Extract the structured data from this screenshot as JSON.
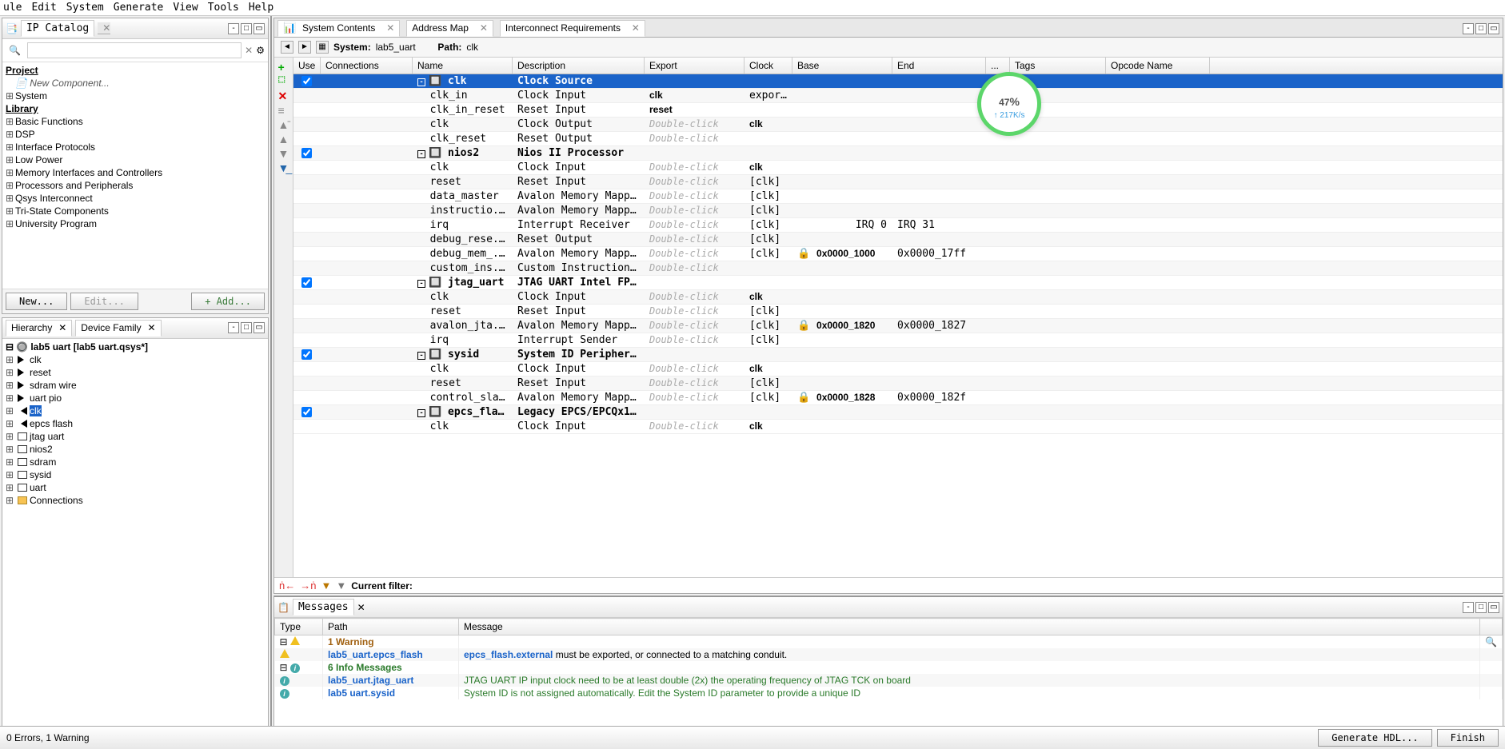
{
  "menu": [
    "ule",
    "Edit",
    "System",
    "Generate",
    "View",
    "Tools",
    "Help"
  ],
  "ip_catalog": {
    "title": "IP Catalog",
    "search_placeholder": "",
    "project_label": "Project",
    "new_component": "New Component...",
    "system": "System",
    "library_label": "Library",
    "items": [
      "Basic Functions",
      "DSP",
      "Interface Protocols",
      "Low Power",
      "Memory Interfaces and Controllers",
      "Processors and Peripherals",
      "Qsys Interconnect",
      "Tri-State Components",
      "University Program"
    ],
    "new_btn": "New...",
    "edit_btn": "Edit...",
    "add_btn": "+ Add..."
  },
  "hierarchy": {
    "tabs": [
      "Hierarchy",
      "Device Family"
    ],
    "root": "lab5 uart [lab5 uart.qsys*]",
    "items": [
      {
        "name": "clk",
        "icon": "right"
      },
      {
        "name": "reset",
        "icon": "right"
      },
      {
        "name": "sdram wire",
        "icon": "right"
      },
      {
        "name": "uart pio",
        "icon": "right"
      },
      {
        "name": "clk",
        "icon": "left",
        "selected": true
      },
      {
        "name": "epcs flash",
        "icon": "left"
      },
      {
        "name": "jtag uart",
        "icon": "chip"
      },
      {
        "name": "nios2",
        "icon": "chip"
      },
      {
        "name": "sdram",
        "icon": "chip"
      },
      {
        "name": "sysid",
        "icon": "chip"
      },
      {
        "name": "uart",
        "icon": "chip"
      },
      {
        "name": "Connections",
        "icon": "folder"
      }
    ]
  },
  "system_contents": {
    "tabs": [
      "System Contents",
      "Address Map",
      "Interconnect Requirements"
    ],
    "system_label": "System:",
    "system_name": "lab5_uart",
    "path_label": "Path:",
    "path_value": "clk",
    "columns": [
      "Use",
      "Connections",
      "Name",
      "Description",
      "Export",
      "Clock",
      "Base",
      "End",
      "...",
      "Tags",
      "Opcode Name"
    ],
    "filter_label": "Current filter:",
    "rows": [
      {
        "use": true,
        "comp": true,
        "selected": true,
        "name": "clk",
        "desc": "Clock Source"
      },
      {
        "name": "clk_in",
        "desc": "Clock Input",
        "export": "clk",
        "clock": "exporte"
      },
      {
        "name": "clk_in_reset",
        "desc": "Reset Input",
        "export": "reset"
      },
      {
        "name": "clk",
        "desc": "Clock Output",
        "export_dc": true,
        "clock": "clk"
      },
      {
        "name": "clk_reset",
        "desc": "Reset Output",
        "export_dc": true
      },
      {
        "use": true,
        "comp": true,
        "name": "nios2",
        "desc": "Nios II Processor"
      },
      {
        "name": "clk",
        "desc": "Clock Input",
        "export_dc": true,
        "clock": "clk"
      },
      {
        "name": "reset",
        "desc": "Reset Input",
        "export_dc": true,
        "clock": "[clk]"
      },
      {
        "name": "data_master",
        "desc": "Avalon Memory Mapp...",
        "export_dc": true,
        "clock": "[clk]"
      },
      {
        "name": "instructio...",
        "desc": "Avalon Memory Mapp...",
        "export_dc": true,
        "clock": "[clk]"
      },
      {
        "name": "irq",
        "desc": "Interrupt Receiver",
        "export_dc": true,
        "clock": "[clk]",
        "base": "IRQ 0",
        "end": "IRQ 31",
        "base_right": true
      },
      {
        "name": "debug_rese...",
        "desc": "Reset Output",
        "export_dc": true,
        "clock": "[clk]"
      },
      {
        "name": "debug_mem_...",
        "desc": "Avalon Memory Mapp...",
        "export_dc": true,
        "clock": "[clk]",
        "base": "0x0000_1000",
        "end": "0x0000_17ff",
        "lock": true,
        "base_bold": true
      },
      {
        "name": "custom_ins...",
        "desc": "Custom Instruction...",
        "export_dc": true
      },
      {
        "use": true,
        "comp": true,
        "name": "jtag_uart",
        "desc": "JTAG UART Intel FP..."
      },
      {
        "name": "clk",
        "desc": "Clock Input",
        "export_dc": true,
        "clock": "clk"
      },
      {
        "name": "reset",
        "desc": "Reset Input",
        "export_dc": true,
        "clock": "[clk]"
      },
      {
        "name": "avalon_jta...",
        "desc": "Avalon Memory Mapp...",
        "export_dc": true,
        "clock": "[clk]",
        "base": "0x0000_1820",
        "end": "0x0000_1827",
        "lock": true,
        "base_bold": true
      },
      {
        "name": "irq",
        "desc": "Interrupt Sender",
        "export_dc": true,
        "clock": "[clk]"
      },
      {
        "use": true,
        "comp": true,
        "name": "sysid",
        "desc": "System ID Peripher..."
      },
      {
        "name": "clk",
        "desc": "Clock Input",
        "export_dc": true,
        "clock": "clk"
      },
      {
        "name": "reset",
        "desc": "Reset Input",
        "export_dc": true,
        "clock": "[clk]"
      },
      {
        "name": "control_slave",
        "desc": "Avalon Memory Mapp...",
        "export_dc": true,
        "clock": "[clk]",
        "base": "0x0000_1828",
        "end": "0x0000_182f",
        "lock": true,
        "base_bold": true
      },
      {
        "use": true,
        "comp": true,
        "name": "epcs_flash",
        "desc": "Legacy EPCS/EPCQx1..."
      },
      {
        "name": "clk",
        "desc": "Clock Input",
        "export_dc": true,
        "clock": "clk"
      }
    ]
  },
  "messages": {
    "title": "Messages",
    "columns": [
      "Type",
      "Path",
      "Message"
    ],
    "rows": [
      {
        "icon": "warn",
        "path": "1 Warning",
        "cls": "msg-warn",
        "expand": true
      },
      {
        "icon": "warn",
        "path": "lab5_uart.epcs_flash",
        "msg_prefix": "epcs_flash.external",
        "msg_rest": " must be exported, or connected to a matching conduit.",
        "cls": "msg-link",
        "msg_cls": "msg-black"
      },
      {
        "icon": "info",
        "path": "6 Info Messages",
        "cls": "msg-green",
        "expand": true
      },
      {
        "icon": "info",
        "path": "lab5_uart.jtag_uart",
        "msg": "JTAG UART IP input clock need to be at least double (2x) the operating frequency of JTAG TCK on board",
        "cls": "msg-link",
        "msg_cls": "msg-green"
      },
      {
        "icon": "info",
        "path": "lab5 uart.sysid",
        "msg": "System ID is not assigned automatically. Edit the System ID parameter to provide a unique ID",
        "cls": "msg-link",
        "msg_cls": "msg-green"
      }
    ]
  },
  "status": {
    "text": "0 Errors, 1 Warning",
    "gen_btn": "Generate HDL...",
    "finish_btn": "Finish"
  },
  "badge": {
    "pct": "47",
    "unit": "%",
    "rate": "↑ 217K/s"
  },
  "double_click": "Double-click"
}
